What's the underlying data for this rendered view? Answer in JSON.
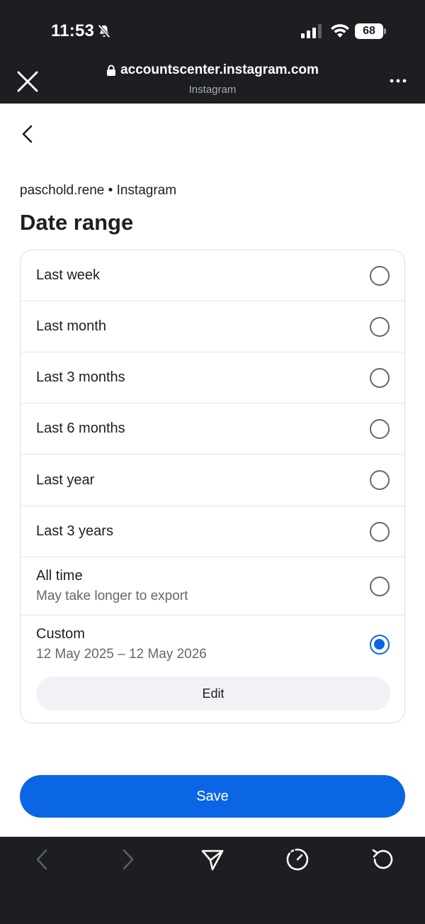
{
  "status_bar": {
    "time": "11:53",
    "battery": "68"
  },
  "browser": {
    "url": "accountscenter.instagram.com",
    "subtitle": "Instagram"
  },
  "page": {
    "account_line": "paschold.rene • Instagram",
    "title": "Date range"
  },
  "options": [
    {
      "label": "Last week",
      "selected": false
    },
    {
      "label": "Last month",
      "selected": false
    },
    {
      "label": "Last 3 months",
      "selected": false
    },
    {
      "label": "Last 6 months",
      "selected": false
    },
    {
      "label": "Last year",
      "selected": false
    },
    {
      "label": "Last 3 years",
      "selected": false
    },
    {
      "label": "All time",
      "sub": "May take longer to export",
      "selected": false
    },
    {
      "label": "Custom",
      "sub": "12 May 2025 – 12 May 2026",
      "selected": true,
      "edit_label": "Edit"
    }
  ],
  "save_label": "Save",
  "colors": {
    "accent": "#0a66e4",
    "chrome": "#1c1e21"
  }
}
